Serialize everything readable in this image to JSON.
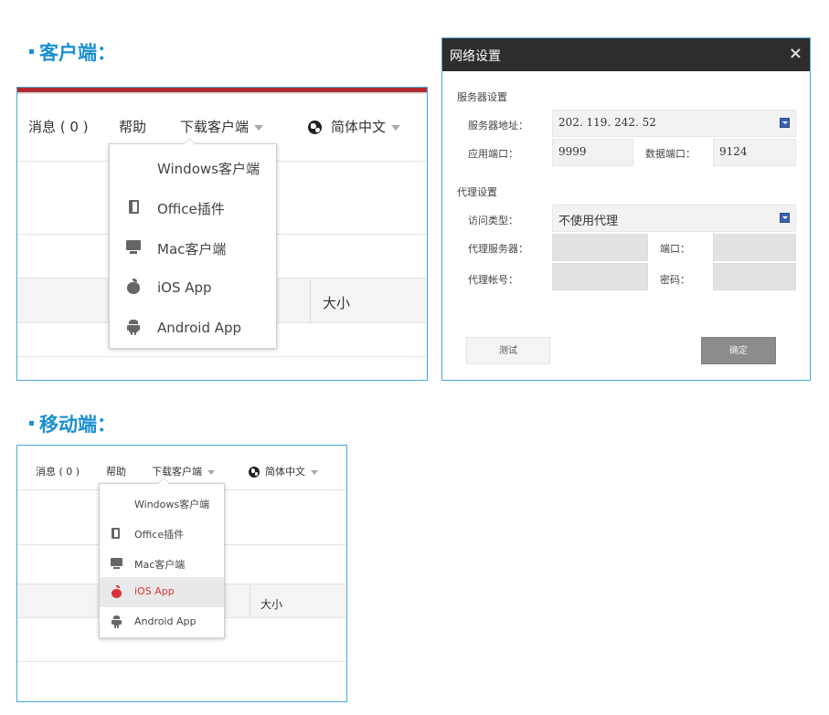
{
  "client_section": {
    "title": "客户端："
  },
  "mobile_section": {
    "title": "移动端："
  },
  "menubar": {
    "messages": "消息 ( 0 )",
    "help": "帮助",
    "download": "下载客户端",
    "language": "简体中文",
    "size_col": "大小"
  },
  "dropdown": {
    "items": [
      {
        "label": "Windows客户端",
        "icon": "windows-icon"
      },
      {
        "label": "Office插件",
        "icon": "office-icon"
      },
      {
        "label": "Mac客户端",
        "icon": "monitor-icon"
      },
      {
        "label": "iOS App",
        "icon": "apple-icon"
      },
      {
        "label": "Android App",
        "icon": "android-icon"
      }
    ],
    "mobile_highlighted_index": 3
  },
  "dialog": {
    "title": "网络设置",
    "close": "×",
    "server_section": "服务器设置",
    "server_address_label": "服务器地址：",
    "server_address_value": "202. 119. 242. 52",
    "app_port_label": "应用端口：",
    "app_port_value": "9999",
    "data_port_label": "数据端口：",
    "data_port_value": "9124",
    "proxy_section": "代理设置",
    "access_type_label": "访问类型：",
    "access_type_value": "不使用代理",
    "proxy_server_label": "代理服务器：",
    "port_label": "端口：",
    "proxy_account_label": "代理帐号：",
    "password_label": "密码：",
    "test_button": "测试",
    "ok_button": "确定"
  },
  "colors": {
    "accent": "#1a8fd1",
    "header_red": "#b22a2f",
    "ios_active": "#d9343a"
  }
}
